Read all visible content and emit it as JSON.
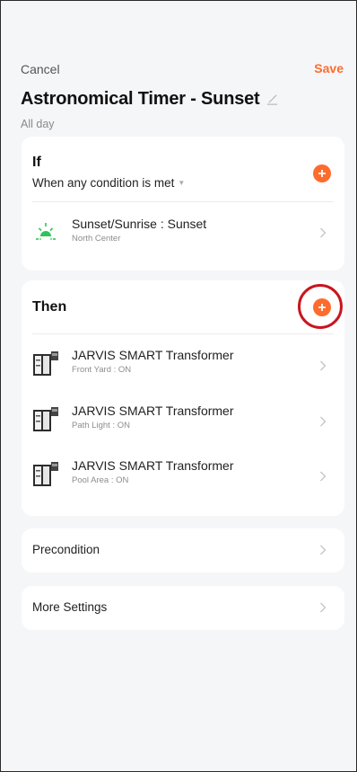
{
  "header": {
    "cancel_label": "Cancel",
    "save_label": "Save",
    "title": "Astronomical Timer - Sunset",
    "subtitle": "All day"
  },
  "if_section": {
    "title": "If",
    "condition_mode": "When any condition is met",
    "conditions": [
      {
        "title": "Sunset/Sunrise : Sunset",
        "subtitle": "North Center",
        "icon": "sun-icon"
      }
    ]
  },
  "then_section": {
    "title": "Then",
    "actions": [
      {
        "title": "JARVIS SMART Transformer",
        "subtitle": "Front Yard : ON",
        "icon": "transformer-device-icon"
      },
      {
        "title": "JARVIS SMART Transformer",
        "subtitle": "Path Light : ON",
        "icon": "transformer-device-icon"
      },
      {
        "title": "JARVIS SMART Transformer",
        "subtitle": "Pool Area : ON",
        "icon": "transformer-device-icon"
      }
    ]
  },
  "precondition": {
    "label": "Precondition"
  },
  "more_settings": {
    "label": "More Settings"
  },
  "colors": {
    "accent": "#ff6b2c",
    "highlight": "#c8161e",
    "sun_icon": "#2fc25b"
  }
}
